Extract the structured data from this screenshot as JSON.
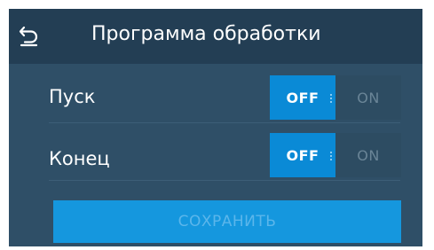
{
  "header": {
    "back_icon": "undo-arrow-icon",
    "title": "Программа обработки"
  },
  "rows": [
    {
      "label": "Пуск",
      "toggle": {
        "off_label": "OFF",
        "on_label": "ON",
        "selected": "OFF"
      }
    },
    {
      "label": "Конец",
      "toggle": {
        "off_label": "OFF",
        "on_label": "ON",
        "selected": "OFF"
      }
    }
  ],
  "save_button": {
    "label": "СОХРАНИТЬ",
    "state": "disabled"
  },
  "colors": {
    "background": "#2f4f67",
    "header": "#233e54",
    "accent": "#0a8ad6",
    "inactive": "#2d4c62"
  }
}
